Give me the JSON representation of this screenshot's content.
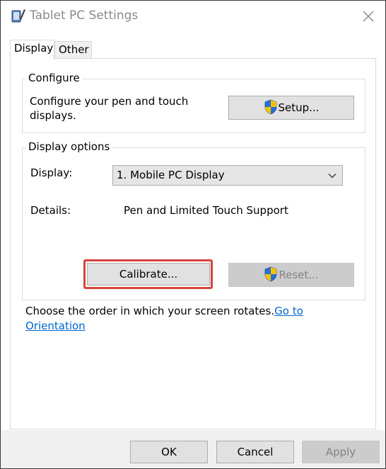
{
  "window": {
    "title": "Tablet PC Settings"
  },
  "tabs": [
    {
      "label": "Display",
      "active": true
    },
    {
      "label": "Other",
      "active": false
    }
  ],
  "configure": {
    "legend": "Configure",
    "description_line1": "Configure your pen and touch",
    "description_line2": "displays.",
    "setup_button": "Setup..."
  },
  "display_options": {
    "legend": "Display options",
    "display_label": "Display:",
    "display_value": "1. Mobile PC Display",
    "details_label": "Details:",
    "details_value": "Pen and Limited Touch Support",
    "calibrate_button": "Calibrate...",
    "reset_button": "Reset..."
  },
  "orientation": {
    "text": "Choose the order in which your screen rotates.",
    "link_part1": "Go to",
    "link_part2": "Orientation"
  },
  "footer": {
    "ok": "OK",
    "cancel": "Cancel",
    "apply": "Apply"
  },
  "colors": {
    "highlight": "#d6443d",
    "link": "#0066cc",
    "shield_blue": "#2a6fd6",
    "shield_yellow": "#f2c200"
  }
}
